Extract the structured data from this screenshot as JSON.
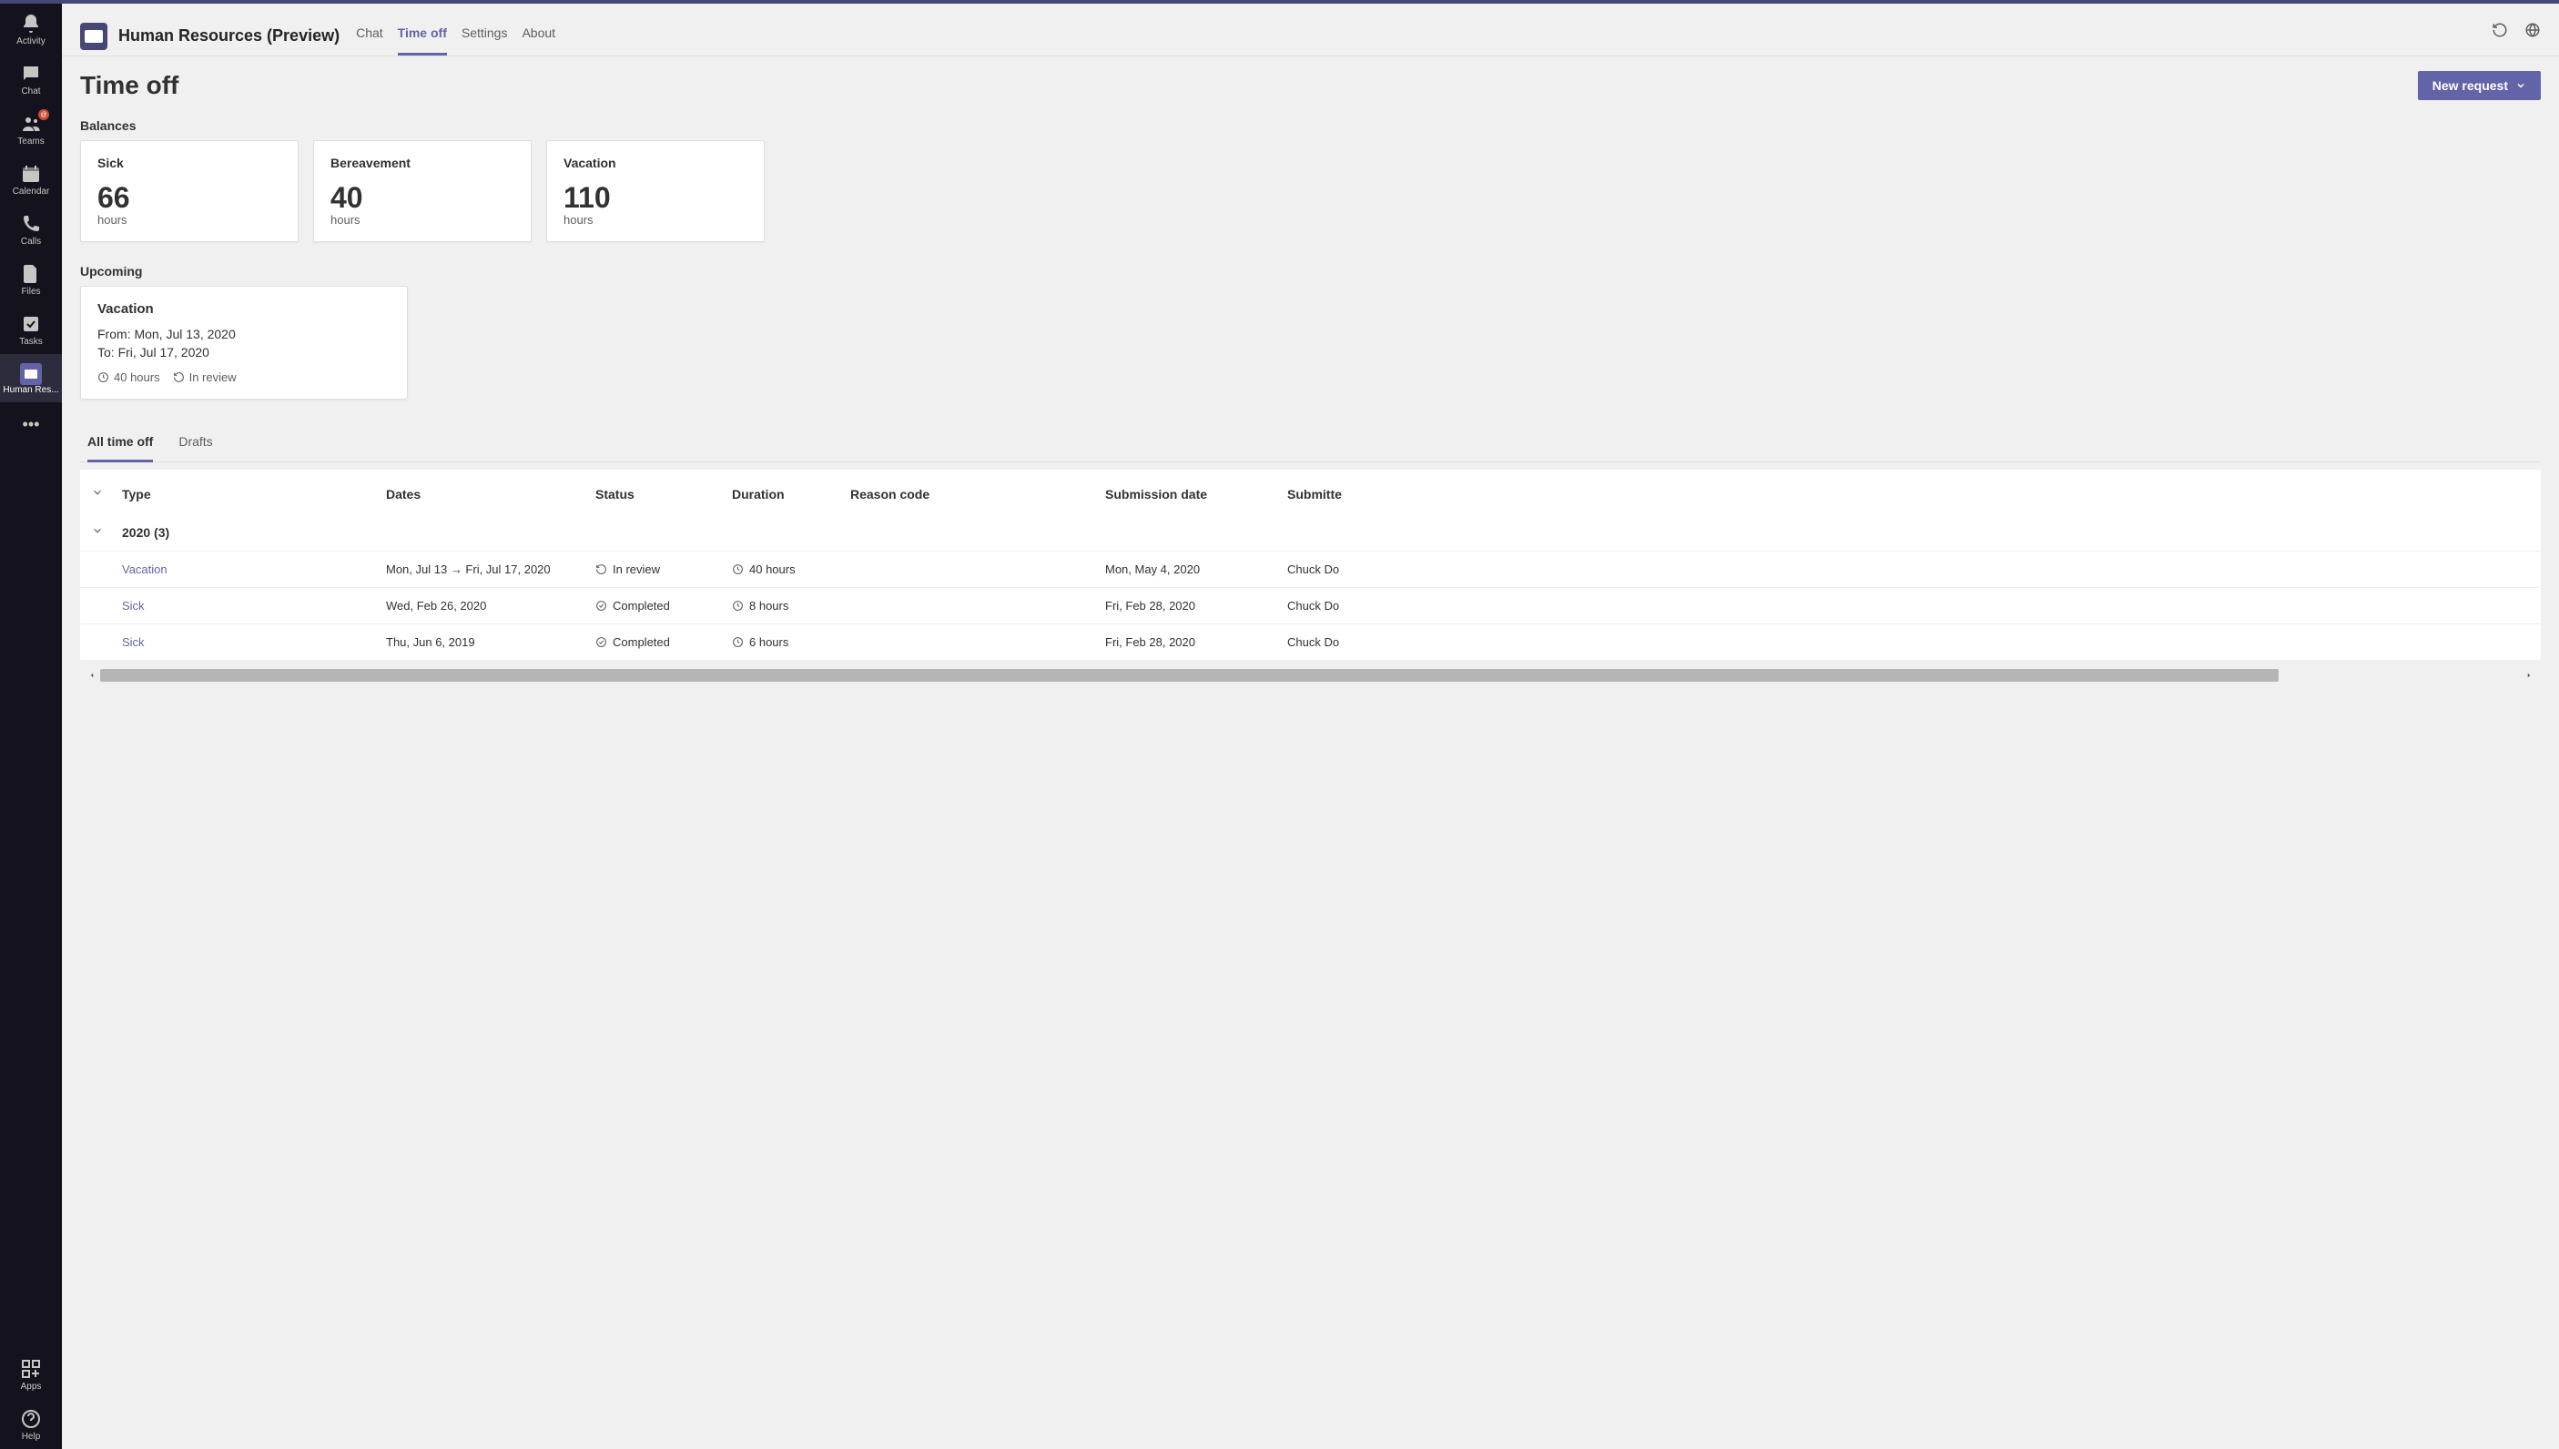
{
  "sidebar": {
    "items": [
      {
        "label": "Activity"
      },
      {
        "label": "Chat"
      },
      {
        "label": "Teams",
        "badge": "@"
      },
      {
        "label": "Calendar"
      },
      {
        "label": "Calls"
      },
      {
        "label": "Files"
      },
      {
        "label": "Tasks"
      },
      {
        "label": "Human Res..."
      }
    ],
    "apps_label": "Apps",
    "help_label": "Help"
  },
  "header": {
    "app_title": "Human Resources (Preview)",
    "tabs": [
      {
        "label": "Chat"
      },
      {
        "label": "Time off",
        "active": true
      },
      {
        "label": "Settings"
      },
      {
        "label": "About"
      }
    ]
  },
  "page": {
    "title": "Time off",
    "new_request_label": "New request"
  },
  "balances": {
    "title": "Balances",
    "cards": [
      {
        "type": "Sick",
        "value": "66",
        "unit": "hours"
      },
      {
        "type": "Bereavement",
        "value": "40",
        "unit": "hours"
      },
      {
        "type": "Vacation",
        "value": "110",
        "unit": "hours"
      }
    ]
  },
  "upcoming": {
    "title": "Upcoming",
    "card": {
      "type": "Vacation",
      "from": "From: Mon, Jul 13, 2020",
      "to": "To: Fri, Jul 17, 2020",
      "hours": "40 hours",
      "status": "In review"
    }
  },
  "sub_tabs": [
    {
      "label": "All time off",
      "active": true
    },
    {
      "label": "Drafts"
    }
  ],
  "table": {
    "columns": [
      "Type",
      "Dates",
      "Status",
      "Duration",
      "Reason code",
      "Submission date",
      "Submitte"
    ],
    "group_label": "2020 (3)",
    "rows": [
      {
        "type": "Vacation",
        "dates": "Mon, Jul 13 → Fri, Jul 17, 2020",
        "status": "In review",
        "status_icon": "review",
        "duration": "40 hours",
        "reason": "",
        "submission": "Mon, May 4, 2020",
        "submitter": "Chuck Do"
      },
      {
        "type": "Sick",
        "dates": "Wed, Feb 26, 2020",
        "status": "Completed",
        "status_icon": "completed",
        "duration": "8 hours",
        "reason": "",
        "submission": "Fri, Feb 28, 2020",
        "submitter": "Chuck Do"
      },
      {
        "type": "Sick",
        "dates": "Thu, Jun 6, 2019",
        "status": "Completed",
        "status_icon": "completed",
        "duration": "6 hours",
        "reason": "",
        "submission": "Fri, Feb 28, 2020",
        "submitter": "Chuck Do"
      }
    ]
  }
}
